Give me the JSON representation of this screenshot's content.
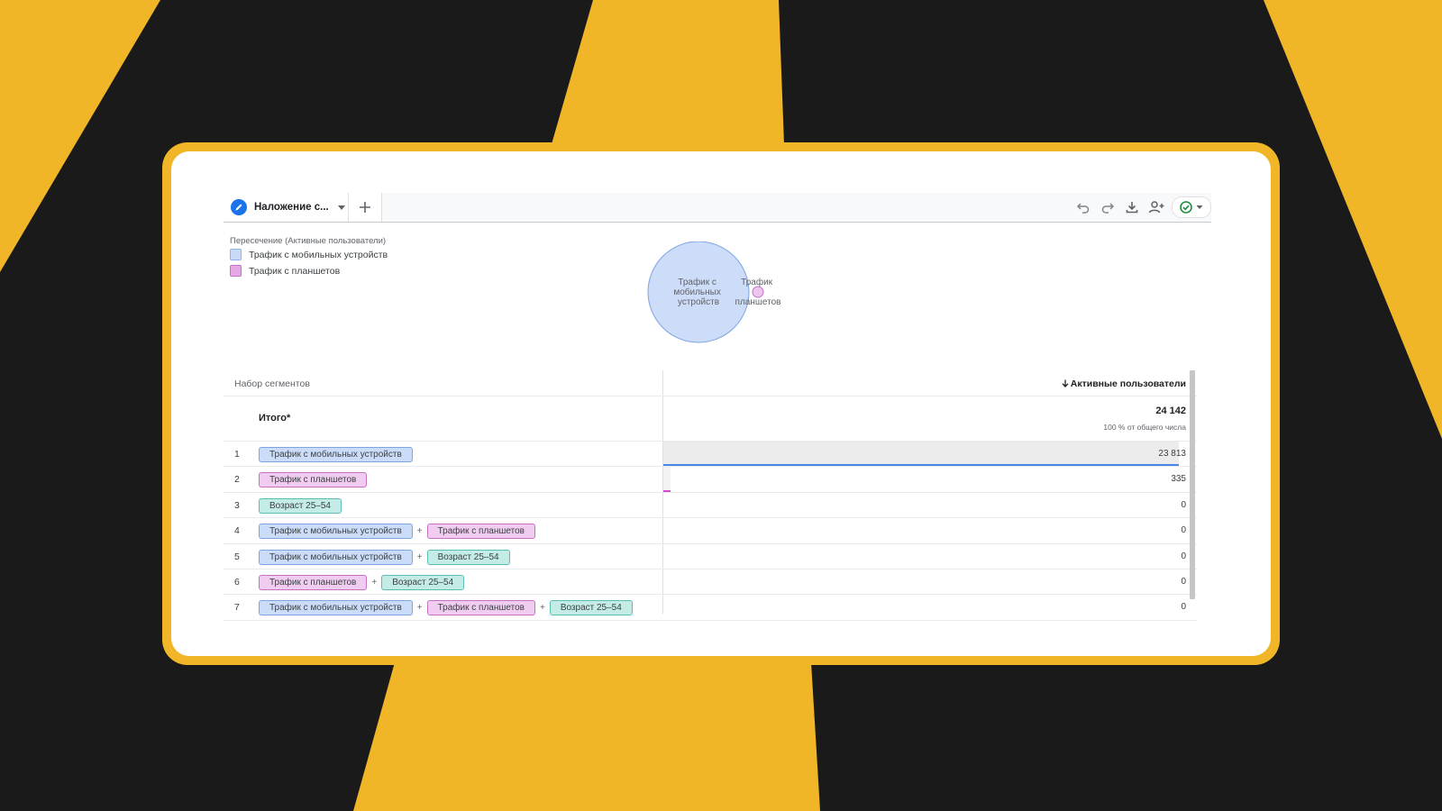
{
  "toolbar": {
    "tab_label": "Наложение с...",
    "icons": [
      "edit-icon",
      "chevron-down-icon",
      "plus-icon",
      "undo-icon",
      "redo-icon",
      "download-icon",
      "share-user-icon",
      "check-circle-icon"
    ]
  },
  "chart": {
    "title": "Пересечение (Активные пользователи)",
    "legend": [
      {
        "label": "Трафик с мобильных устройств",
        "color": "#c9d9f8"
      },
      {
        "label": "Трафик с планшетов",
        "color": "#e6a7e6"
      }
    ],
    "venn": {
      "mobile_label_lines": [
        "Трафик с",
        "мобильных",
        "устройств"
      ],
      "tablet_label_lines": [
        "Трафик",
        "планшетов"
      ],
      "mobile_value": 23813,
      "tablet_value": 335
    }
  },
  "table": {
    "col_segments": "Набор сегментов",
    "col_metric": "Активные пользователи",
    "total": {
      "label": "Итого*",
      "value": "24 142",
      "pct": "100 % от общего числа"
    },
    "rows": [
      {
        "n": "1",
        "value": "23 813",
        "share": 0.986,
        "bar_color": "#4a86e8",
        "chips": [
          {
            "text": "Трафик с мобильных устройств",
            "kind": "mobile"
          }
        ]
      },
      {
        "n": "2",
        "value": "335",
        "share": 0.014,
        "bar_color": "#d04bd0",
        "chips": [
          {
            "text": "Трафик с планшетов",
            "kind": "tablet"
          }
        ]
      },
      {
        "n": "3",
        "value": "0",
        "share": 0,
        "chips": [
          {
            "text": "Возраст 25–54",
            "kind": "age"
          }
        ]
      },
      {
        "n": "4",
        "value": "0",
        "share": 0,
        "chips": [
          {
            "text": "Трафик с мобильных устройств",
            "kind": "mobile"
          },
          {
            "text": "Трафик с планшетов",
            "kind": "tablet"
          }
        ]
      },
      {
        "n": "5",
        "value": "0",
        "share": 0,
        "chips": [
          {
            "text": "Трафик с мобильных устройств",
            "kind": "mobile"
          },
          {
            "text": "Возраст 25–54",
            "kind": "age"
          }
        ]
      },
      {
        "n": "6",
        "value": "0",
        "share": 0,
        "chips": [
          {
            "text": "Трафик с планшетов",
            "kind": "tablet"
          },
          {
            "text": "Возраст 25–54",
            "kind": "age"
          }
        ]
      },
      {
        "n": "7",
        "value": "0",
        "share": 0,
        "chips": [
          {
            "text": "Трафик с мобильных устройств",
            "kind": "mobile"
          },
          {
            "text": "Трафик с планшетов",
            "kind": "tablet"
          },
          {
            "text": "Возраст 25–54",
            "kind": "age"
          }
        ]
      }
    ],
    "plus_sign": "+"
  },
  "colors": {
    "brand_yellow": "#f0b628",
    "background_dark": "#1a1a1a",
    "accent_blue": "#1a73e8",
    "success_green": "#1e8e3e"
  }
}
